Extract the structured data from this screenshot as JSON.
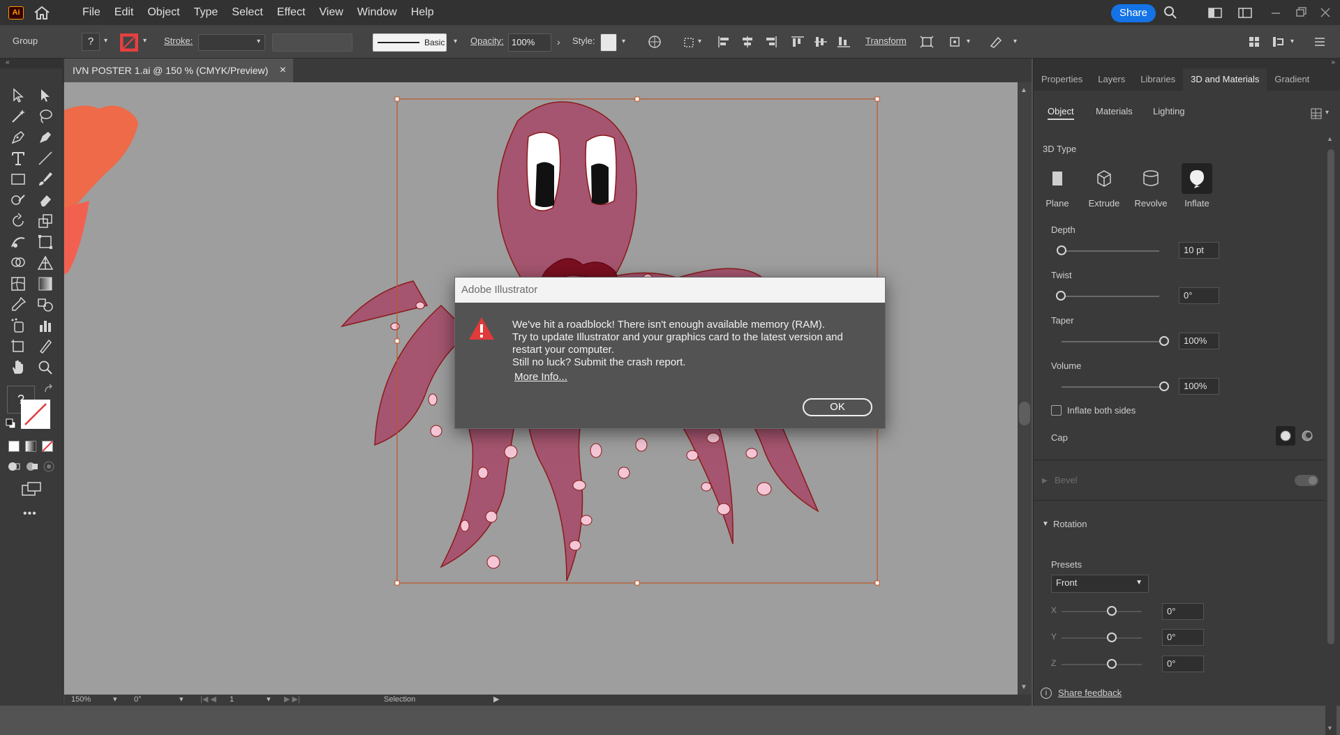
{
  "app": {
    "logo_text": "Ai"
  },
  "menubar": {
    "items": [
      "File",
      "Edit",
      "Object",
      "Type",
      "Select",
      "Effect",
      "View",
      "Window",
      "Help"
    ],
    "share_label": "Share"
  },
  "controlbar": {
    "selection_label": "Group",
    "stroke_label": "Stroke:",
    "brush_label": "Basic",
    "opacity_label": "Opacity:",
    "opacity_value": "100%",
    "style_label": "Style:",
    "transform_label": "Transform",
    "fill_value": "?"
  },
  "document": {
    "tab_title": "IVN POSTER 1.ai @ 150 % (CMYK/Preview)"
  },
  "statusbar": {
    "zoom": "150%",
    "rotation": "0°",
    "artboard": "1",
    "tool": "Selection"
  },
  "panel": {
    "tabs": [
      "Properties",
      "Layers",
      "Libraries",
      "3D and Materials",
      "Gradient"
    ],
    "active_tab": "3D and Materials",
    "subtabs": [
      "Object",
      "Materials",
      "Lighting"
    ],
    "type_heading": "3D Type",
    "types": [
      "Plane",
      "Extrude",
      "Revolve",
      "Inflate"
    ],
    "depth_label": "Depth",
    "depth_value": "10 pt",
    "twist_label": "Twist",
    "twist_value": "0°",
    "taper_label": "Taper",
    "taper_value": "100%",
    "volume_label": "Volume",
    "volume_value": "100%",
    "inflate_both_label": "Inflate both sides",
    "cap_label": "Cap",
    "bevel_label": "Bevel",
    "rotation_label": "Rotation",
    "presets_label": "Presets",
    "presets_value": "Front",
    "x_label": "X",
    "x_value": "0°",
    "y_label": "Y",
    "y_value": "0°",
    "z_label": "Z",
    "z_value": "0°",
    "feedback_label": "Share feedback"
  },
  "dialog": {
    "title": "Adobe Illustrator",
    "message": "We've hit a roadblock! There isn't enough available memory (RAM).\nTry to update Illustrator and your graphics card to the latest version and\nrestart your computer.\nStill no luck? Submit the crash report.",
    "more_info": "More Info...",
    "ok_label": "OK"
  },
  "colors": {
    "accent": "#1473e6",
    "octopus_fill": "#a5556f",
    "octopus_stroke": "#8b1a1a",
    "spot_fill": "#f5c6d6",
    "selection": "#c0552b",
    "warning": "#e03a3a"
  }
}
